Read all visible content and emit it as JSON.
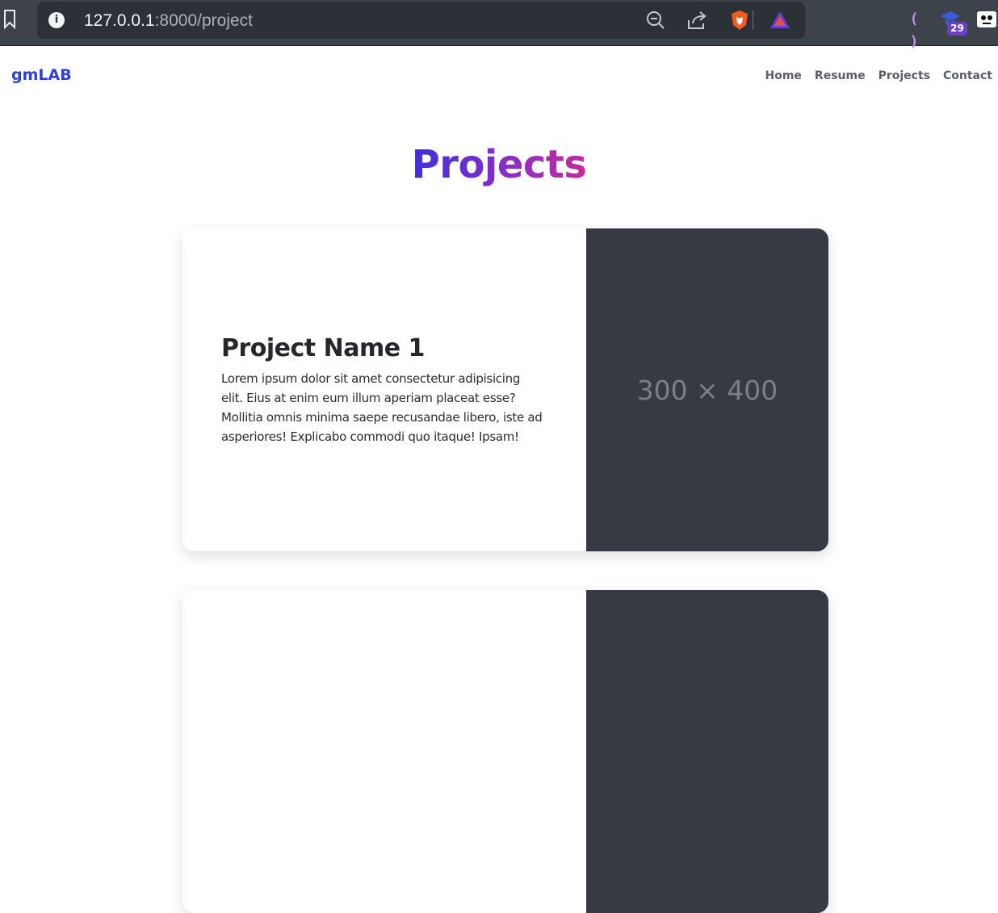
{
  "browser": {
    "url_host": "127.0.0.1",
    "url_rest": ":8000/project",
    "extension_badge": "29"
  },
  "nav": {
    "brand": "gmLAB",
    "links": [
      "Home",
      "Resume",
      "Projects",
      "Contact"
    ]
  },
  "page": {
    "title": "Projects"
  },
  "projects": [
    {
      "name": "Project Name 1",
      "description": "Lorem ipsum dolor sit amet consectetur adipisicing elit. Eius at enim eum illum aperiam placeat esse? Mollitia omnis minima saepe recusandae libero, iste ad asperiores! Explicabo commodi quo itaque! Ipsam!",
      "image_placeholder": "300 × 400"
    },
    {
      "name": "",
      "description": "",
      "image_placeholder": ""
    }
  ],
  "colors": {
    "brand": "#2e3fd6",
    "title_gradient_start": "#3f2fd8",
    "title_gradient_end": "#c52a9b",
    "thumb_bg": "#363a42"
  }
}
